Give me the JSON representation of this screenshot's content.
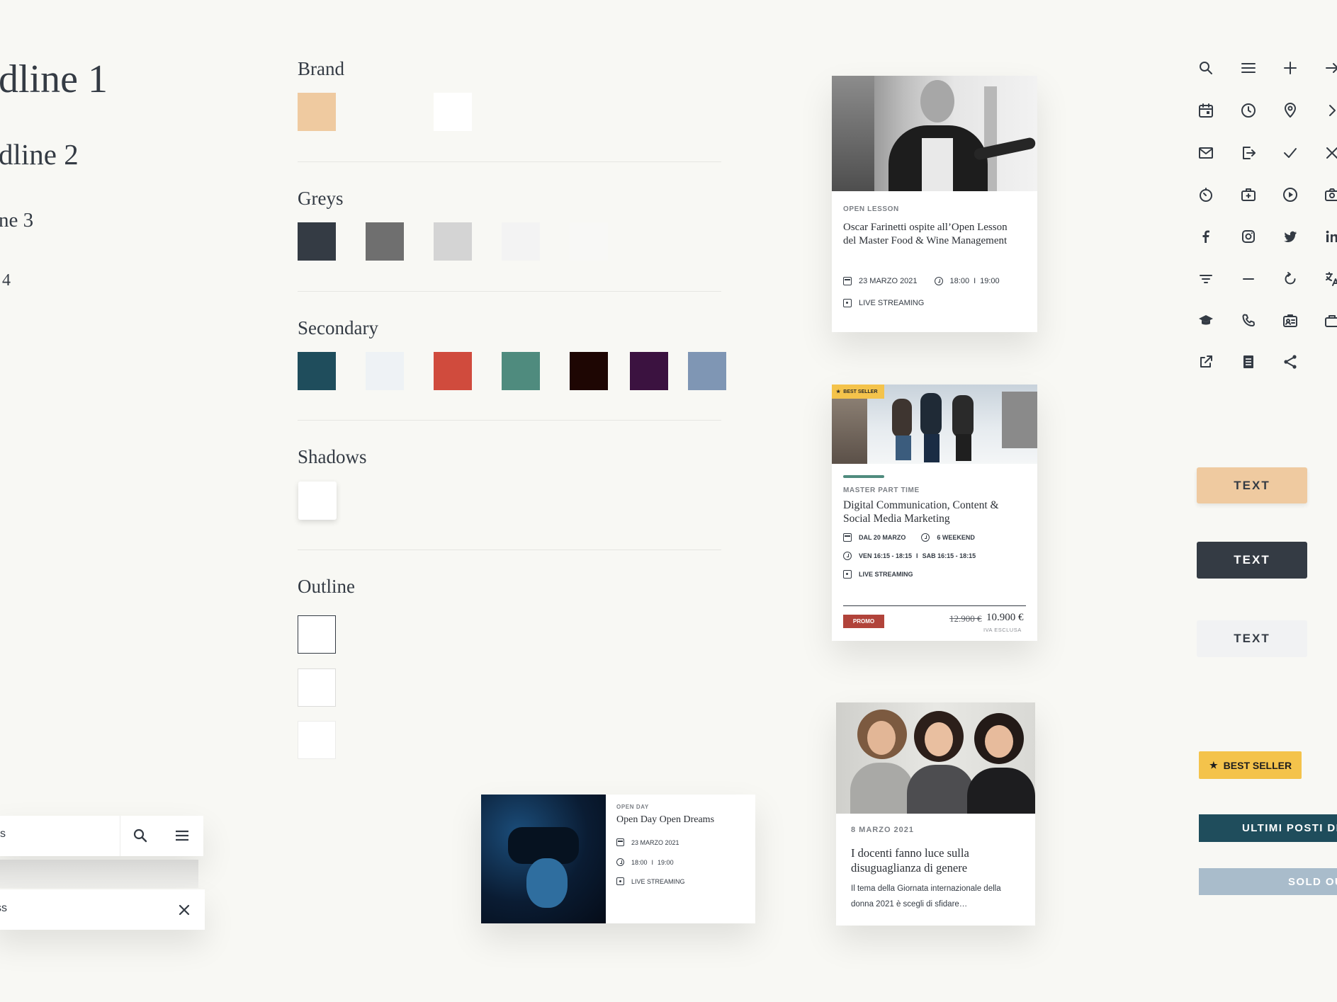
{
  "typography": {
    "h1": "dline 1",
    "h2": "dline 2",
    "h3": "ne 3",
    "h4": "4"
  },
  "palette": {
    "brand": {
      "title": "Brand",
      "colors": [
        "#efcaa0",
        "#ffffff"
      ]
    },
    "greys": {
      "title": "Greys",
      "colors": [
        "#343b44",
        "#6f6f6f",
        "#d4d4d4",
        "#f3f3f3",
        "#f8f8f6"
      ]
    },
    "secondary": {
      "title": "Secondary",
      "colors": [
        "#1f4d5c",
        "#eef2f5",
        "#d04b3d",
        "#4f8b7e",
        "#1e0603",
        "#3b1240",
        "#7f96b4"
      ]
    },
    "shadows": {
      "title": "Shadows"
    },
    "outline": {
      "title": "Outline"
    }
  },
  "card1": {
    "kicker": "OPEN LESSON",
    "title": "Oscar Farinetti ospite all’Open Lesson del Master Food & Wine Management",
    "date": "23 MARZO 2021",
    "time_from": "18:00",
    "time_sep": "I",
    "time_to": "19:00",
    "mode": "LIVE STREAMING"
  },
  "card2": {
    "badge": "BEST SELLER",
    "kicker": "MASTER PART TIME",
    "title": "Digital Communication, Content & Social Media Marketing",
    "date": "DAL 20 MARZO",
    "duration": "6 WEEKEND",
    "schedule_a": "VEN 16:15 - 18:15",
    "schedule_sep": "I",
    "schedule_b": "SAB 16:15 - 18:15",
    "mode": "LIVE STREAMING",
    "promo": "PROMO",
    "old_price": "12.900 €",
    "price": "10.900 €",
    "vat": "IVA ESCLUSA"
  },
  "card3": {
    "date": "8 MARZO 2021",
    "title": "I docenti fanno luce sulla disuguaglianza di genere",
    "excerpt": "Il tema della Giornata internazionale della donna 2021 è scegli di sfidare…"
  },
  "card4": {
    "kicker": "OPEN DAY",
    "title": "Open Day Open Dreams",
    "date": "23 MARZO 2021",
    "time_from": "18:00",
    "time_sep": "I",
    "time_to": "19:00",
    "mode": "LIVE STREAMING"
  },
  "search": {
    "row1_text": "s",
    "row2_text": "ss"
  },
  "icons": [
    "search-icon",
    "menu-icon",
    "plus-icon",
    "arrow-right-icon",
    "calendar-icon",
    "clock-icon",
    "location-pin-icon",
    "chevron-right-icon",
    "mail-icon",
    "logout-icon",
    "check-icon",
    "close-icon",
    "timer-icon",
    "briefcase-medical-icon",
    "video-play-icon",
    "camera-icon",
    "facebook-icon",
    "instagram-icon",
    "twitter-icon",
    "linkedin-icon",
    "filter-icon",
    "minus-icon",
    "refresh-icon",
    "translate-icon",
    "graduation-cap-icon",
    "phone-icon",
    "id-card-icon",
    "bag-icon",
    "external-link-icon",
    "document-icon",
    "share-icon"
  ],
  "buttons": {
    "primary": "TEXT",
    "dark": "TEXT",
    "light": "TEXT"
  },
  "badges": {
    "best_seller": "BEST SELLER",
    "ultimi": "ULTIMI POSTI DIS",
    "sold_out": "SOLD OU"
  }
}
